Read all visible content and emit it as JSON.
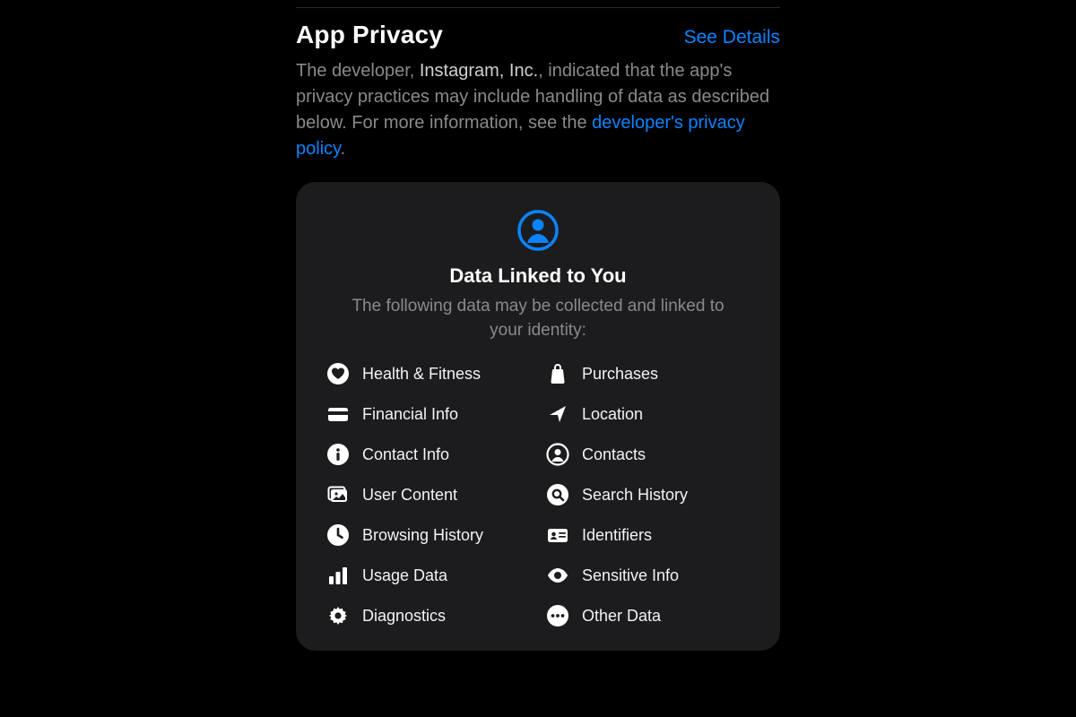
{
  "header": {
    "title": "App Privacy",
    "see_details": "See Details"
  },
  "description": {
    "pre": "The developer, ",
    "developer": "Instagram, Inc.",
    "mid": ", indicated that the app's privacy practices may include handling of data as described below. For more information, see the ",
    "policy_link": "developer's privacy policy",
    "post": "."
  },
  "card": {
    "icon_name": "person-linked-icon",
    "title": "Data Linked to You",
    "subtitle": "The following data may be collected and linked to your identity:",
    "items": [
      {
        "icon": "heart-icon",
        "label": "Health & Fitness"
      },
      {
        "icon": "bag-icon",
        "label": "Purchases"
      },
      {
        "icon": "creditcard-icon",
        "label": "Financial Info"
      },
      {
        "icon": "location-icon",
        "label": "Location"
      },
      {
        "icon": "info-icon",
        "label": "Contact Info"
      },
      {
        "icon": "contacts-icon",
        "label": "Contacts"
      },
      {
        "icon": "photo-icon",
        "label": "User Content"
      },
      {
        "icon": "search-icon",
        "label": "Search History"
      },
      {
        "icon": "clock-icon",
        "label": "Browsing History"
      },
      {
        "icon": "idcard-icon",
        "label": "Identifiers"
      },
      {
        "icon": "chart-icon",
        "label": "Usage Data"
      },
      {
        "icon": "eye-icon",
        "label": "Sensitive Info"
      },
      {
        "icon": "gear-icon",
        "label": "Diagnostics"
      },
      {
        "icon": "ellipsis-icon",
        "label": "Other Data"
      }
    ]
  },
  "colors": {
    "link": "#0a84ff",
    "card_bg": "#1c1c1e",
    "muted": "#8a8a8e"
  }
}
